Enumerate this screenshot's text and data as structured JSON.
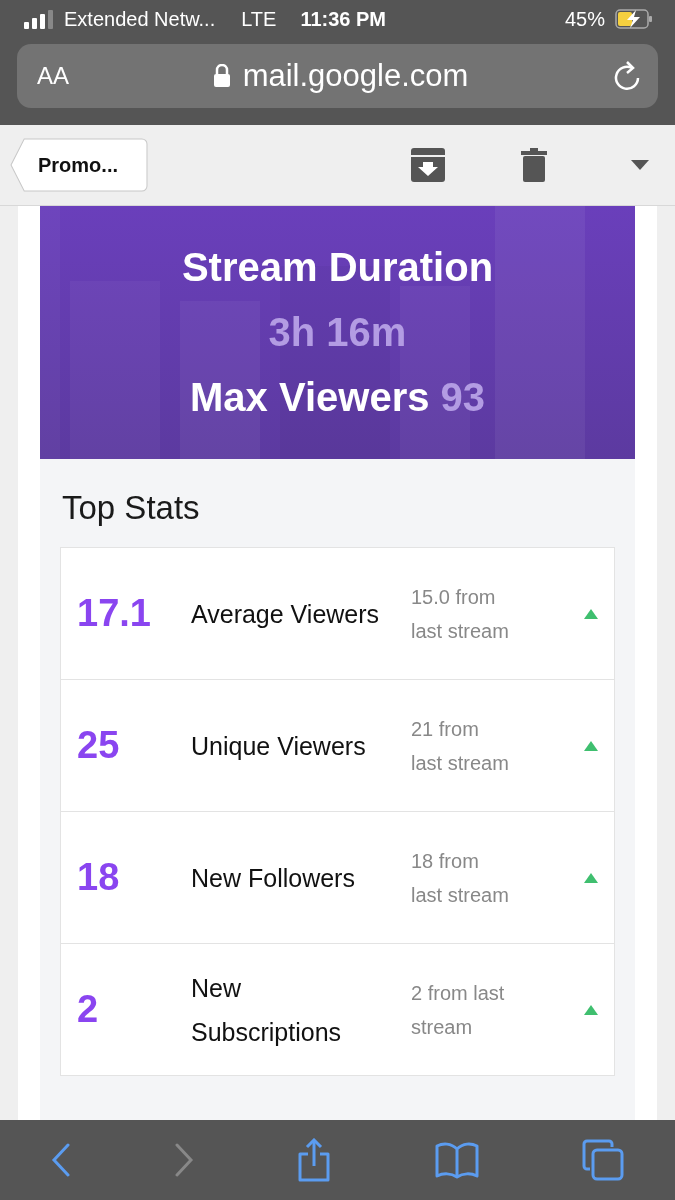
{
  "status_bar": {
    "carrier": "Extended Netw...",
    "network": "LTE",
    "time": "11:36 PM",
    "battery": "45%"
  },
  "address_bar": {
    "text_size": "AA",
    "url": "mail.google.com"
  },
  "mail_toolbar": {
    "back_label": "Promo..."
  },
  "banner": {
    "title": "Stream Duration",
    "duration": "3h 16m",
    "max_viewers_label": "Max Viewers",
    "max_viewers_value": "93"
  },
  "top_stats": {
    "title": "Top Stats",
    "rows": [
      {
        "value": "17.1",
        "label": "Average Viewers",
        "change": "15.0 from last stream",
        "increase": true
      },
      {
        "value": "25",
        "label": "Unique Viewers",
        "change": "21 from last stream",
        "increase": true
      },
      {
        "value": "18",
        "label": "New Followers",
        "change": "18 from last stream",
        "increase": true
      },
      {
        "value": "2",
        "label": "New Subscriptions",
        "change": "2 from last stream",
        "increase": true
      }
    ]
  },
  "browser_toolbar": {
    "forward_disabled": true
  }
}
